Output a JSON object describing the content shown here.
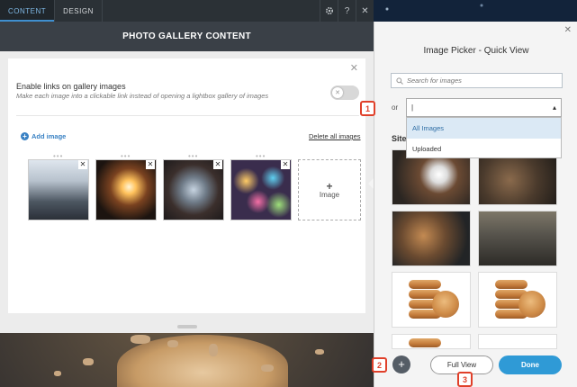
{
  "tabs": [
    {
      "label": "CONTENT"
    },
    {
      "label": "DESIGN"
    }
  ],
  "toolbar": {
    "settings_icon": "gear-icon",
    "help_label": "?",
    "close_label": "✕"
  },
  "panel": {
    "title": "PHOTO GALLERY CONTENT",
    "toggle": {
      "title": "Enable links on gallery images",
      "description": "Make each image into a clickable link instead of opening a lightbox gallery of images",
      "state": "off"
    },
    "add_image_label": "Add image",
    "delete_all_label": "Delete all images",
    "add_tile_label": "Image",
    "thumbnails": [
      "city skyline",
      "sparkler",
      "tablet on desk",
      "bokeh lights"
    ]
  },
  "picker": {
    "title": "Image Picker - Quick View",
    "search_placeholder": "Search for images",
    "or_label": "or",
    "select_value": "|",
    "options": [
      {
        "label": "All Images"
      },
      {
        "label": "Uploaded"
      }
    ],
    "section_label": "Site",
    "full_view_label": "Full View",
    "done_label": "Done",
    "accent": "#2f9ad6"
  },
  "callouts": {
    "one": "1",
    "two": "2",
    "three": "3"
  }
}
